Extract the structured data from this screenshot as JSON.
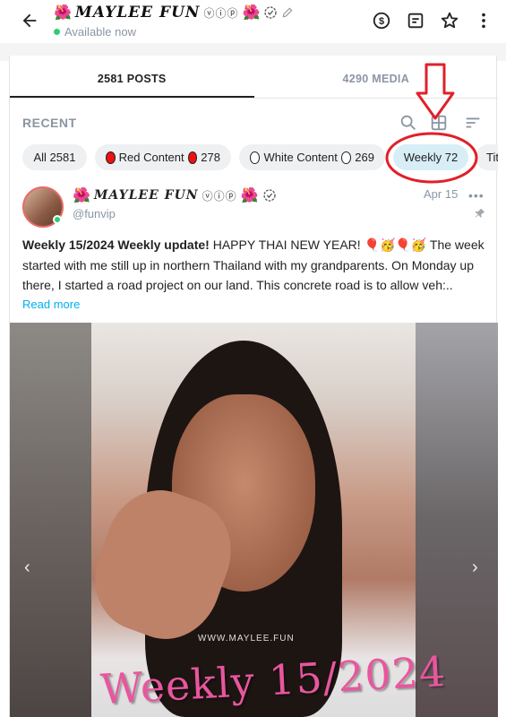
{
  "header": {
    "title": "MAYLEE FUN",
    "title_flower": "🌺",
    "title_vip": "ⓥⓘⓟ",
    "status": "Available now"
  },
  "tabs": [
    {
      "label": "2581 POSTS",
      "active": true
    },
    {
      "label": "4290 MEDIA",
      "active": false
    }
  ],
  "recent": {
    "label": "RECENT"
  },
  "chips": [
    {
      "label": "All 2581"
    },
    {
      "label": "Red Content",
      "count": "278"
    },
    {
      "label": "White Content",
      "count": "269"
    },
    {
      "label": "Weekly 72",
      "active": true
    },
    {
      "label": "Tit"
    }
  ],
  "post": {
    "author": "MAYLEE FUN",
    "author_vip": "ⓥⓘⓟ",
    "handle": "@funvip",
    "date": "Apr 15",
    "text_bold": "Weekly 15/2024 Weekly update!",
    "text_rest": " HAPPY THAI NEW YEAR! 🎈🥳🎈🥳 The week started with me still up in northern Thailand with my grandparents. On Monday up there, I started a road project on our land. This concrete road is to allow veh:..",
    "read_more": "Read more"
  },
  "media": {
    "watermark_site": "WWW.MAYLEE.FUN",
    "overlay_text": "Weekly 15/2024"
  },
  "colors": {
    "accent": "#00aff0",
    "online": "#2ecc71",
    "annotation": "#e0202a",
    "chip_active": "#d7eef7"
  }
}
